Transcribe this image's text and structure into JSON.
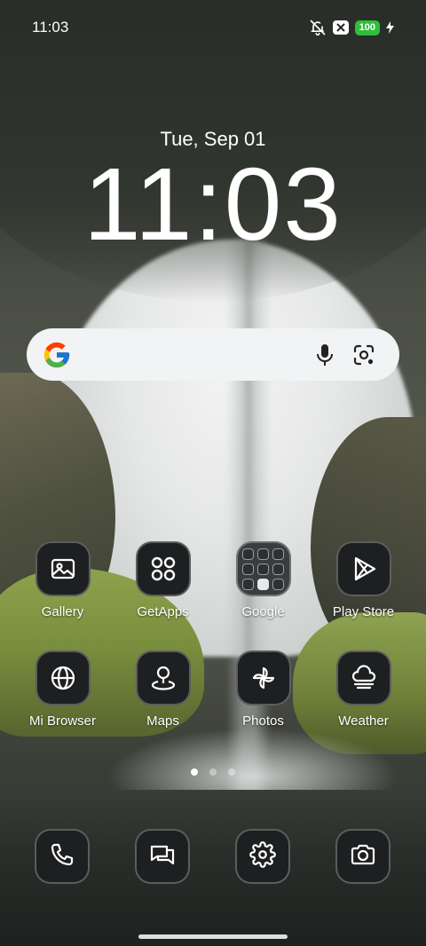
{
  "status_bar": {
    "time": "11:03",
    "battery": "100",
    "icons": [
      "bell-off-icon",
      "x-badge-icon",
      "battery-icon",
      "charging-icon"
    ]
  },
  "lockclock": {
    "date": "Tue, Sep 01",
    "time": "11:03"
  },
  "search": {
    "icons": [
      "google-logo-icon",
      "microphone-icon",
      "lens-camera-icon"
    ]
  },
  "apps": [
    {
      "label": "Gallery",
      "icon": "gallery-icon"
    },
    {
      "label": "GetApps",
      "icon": "getapps-icon"
    },
    {
      "label": "Google",
      "icon": "google-folder-icon"
    },
    {
      "label": "Play Store",
      "icon": "play-store-icon"
    },
    {
      "label": "Mi Browser",
      "icon": "globe-icon"
    },
    {
      "label": "Maps",
      "icon": "map-pin-icon"
    },
    {
      "label": "Photos",
      "icon": "pinwheel-icon"
    },
    {
      "label": "Weather",
      "icon": "cloud-fog-icon"
    }
  ],
  "pages": {
    "count": 3,
    "active": 1
  },
  "dock": [
    {
      "icon": "phone-icon"
    },
    {
      "icon": "messages-icon"
    },
    {
      "icon": "settings-gear-icon"
    },
    {
      "icon": "camera-icon"
    }
  ],
  "colors": {
    "tile": "#1d1f21",
    "battery": "#2fbf39",
    "search_bg": "#f1f3f4"
  }
}
